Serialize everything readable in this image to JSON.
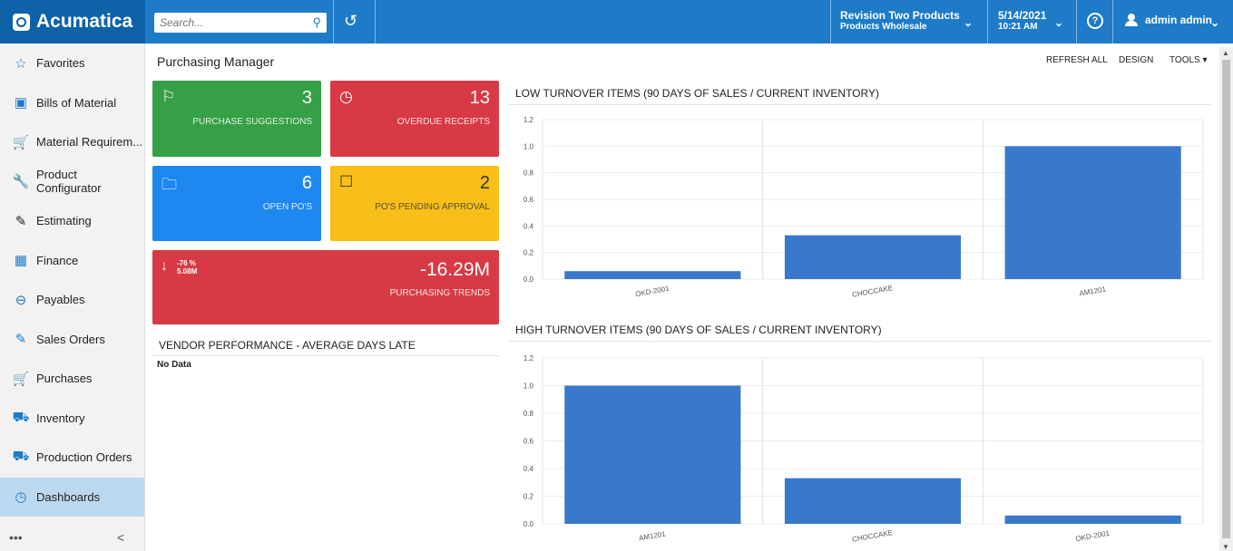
{
  "app": {
    "name": "Acumatica"
  },
  "topbar": {
    "search_placeholder": "Search...",
    "company_line1": "Revision Two Products",
    "company_line2": "Products Wholesale",
    "date": "5/14/2021",
    "time": "10:21 AM",
    "user": "admin admin"
  },
  "sidebar": {
    "items": [
      {
        "label": "Favorites",
        "icon": "star-icon"
      },
      {
        "label": "Bills of Material",
        "icon": "document-dollar-icon"
      },
      {
        "label": "Material Requirem...",
        "icon": "cart-plus-icon"
      },
      {
        "label": "Product Configurator",
        "icon": "wrench-icon"
      },
      {
        "label": "Estimating",
        "icon": "pencil-icon"
      },
      {
        "label": "Finance",
        "icon": "calculator-icon"
      },
      {
        "label": "Payables",
        "icon": "minus-circle-icon"
      },
      {
        "label": "Sales Orders",
        "icon": "edit-box-icon"
      },
      {
        "label": "Purchases",
        "icon": "cart-icon"
      },
      {
        "label": "Inventory",
        "icon": "truck-icon"
      },
      {
        "label": "Production Orders",
        "icon": "truck-icon"
      },
      {
        "label": "Dashboards",
        "icon": "gauge-icon"
      }
    ],
    "active_index": 11,
    "more_label": "•••",
    "collapse_label": "<"
  },
  "page": {
    "title": "Purchasing Manager",
    "actions": {
      "refresh": "REFRESH ALL",
      "design": "DESIGN",
      "tools": "TOOLS"
    }
  },
  "tiles": {
    "purchase_suggestions": {
      "value": "3",
      "label": "PURCHASE SUGGESTIONS",
      "color": "#36a047"
    },
    "overdue_receipts": {
      "value": "13",
      "label": "OVERDUE RECEIPTS",
      "color": "#d73a45"
    },
    "open_pos": {
      "value": "6",
      "label": "OPEN PO'S",
      "color": "#1e88f0"
    },
    "pending_approval": {
      "value": "2",
      "label": "PO'S PENDING APPROVAL",
      "color": "#f8bf1a"
    },
    "purchasing_trends": {
      "value": "-16.29M",
      "label": "PURCHASING TRENDS",
      "pct": "-76 %",
      "prev": "5.08M",
      "color": "#d73a45"
    }
  },
  "vendor_performance": {
    "title": "VENDOR PERFORMANCE - AVERAGE DAYS LATE",
    "empty_text": "No Data"
  },
  "chart_data": [
    {
      "type": "bar",
      "title": "LOW TURNOVER ITEMS (90 DAYS OF SALES / CURRENT INVENTORY)",
      "categories": [
        "OKD-2001",
        "CHOCCAKE",
        "AM1201"
      ],
      "values": [
        0.06,
        0.33,
        1.0
      ],
      "ylim": [
        0,
        1.2
      ],
      "yticks": [
        "0.0",
        "0.2",
        "0.4",
        "0.6",
        "0.8",
        "1.0",
        "1.2"
      ],
      "color": "#3a78cc",
      "grid": true
    },
    {
      "type": "bar",
      "title": "HIGH TURNOVER ITEMS (90 DAYS OF SALES / CURRENT INVENTORY)",
      "categories": [
        "AM1201",
        "CHOCCAKE",
        "OKD-2001"
      ],
      "values": [
        1.0,
        0.33,
        0.06
      ],
      "ylim": [
        0,
        1.2
      ],
      "yticks": [
        "0.0",
        "0.2",
        "0.4",
        "0.6",
        "0.8",
        "1.0",
        "1.2"
      ],
      "color": "#3a78cc",
      "grid": true
    }
  ]
}
